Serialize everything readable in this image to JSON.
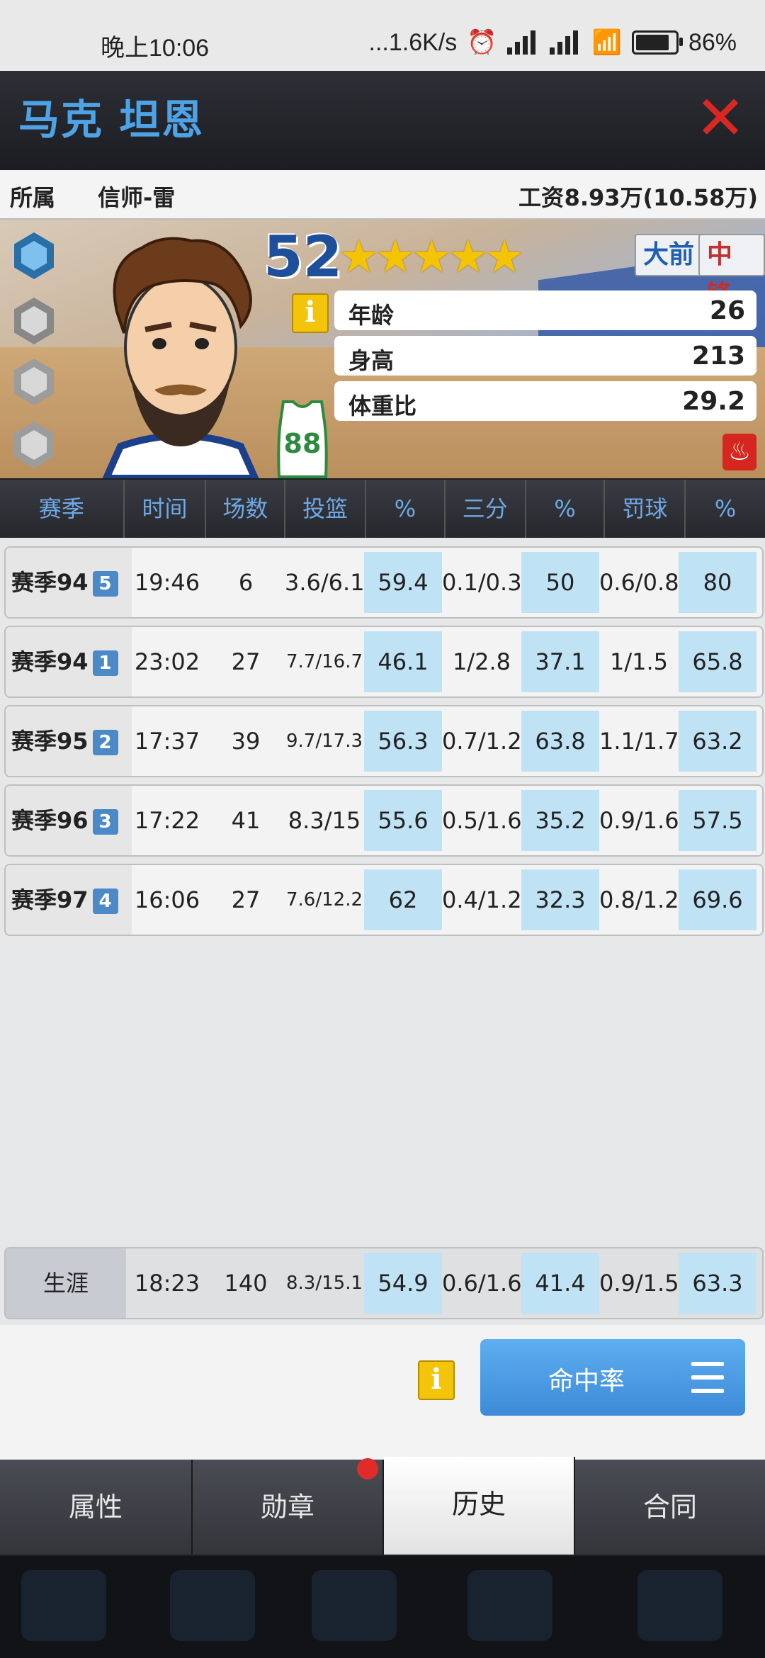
{
  "status": {
    "time": "晚上10:06",
    "network": "...1.6K/s",
    "battery": "86%",
    "battery_level": 0.86
  },
  "player": {
    "name": "马克 坦恩",
    "team_label": "所属",
    "team": "信师-雷",
    "salary_label": "工资",
    "salary": "8.93万(10.58万)",
    "rating": "52",
    "stars": "★★★★★",
    "star_rating": 4.5,
    "positions": [
      "大前",
      "中锋"
    ],
    "jersey": "88",
    "attributes": [
      {
        "label": "年龄",
        "value": "26"
      },
      {
        "label": "身高",
        "value": "213"
      },
      {
        "label": "体重比",
        "value": "29.2"
      }
    ]
  },
  "table": {
    "headers": [
      "赛季",
      "时间",
      "场数",
      "投篮",
      "%",
      "三分",
      "%",
      "罚球",
      "%"
    ],
    "rows": [
      {
        "season": "赛季94",
        "badge": "5",
        "time": "19:46",
        "games": "6",
        "fg": "3.6/6.1",
        "fg_pct": "59.4",
        "three": "0.1/0.3",
        "three_pct": "50",
        "ft": "0.6/0.8",
        "ft_pct": "80"
      },
      {
        "season": "赛季94",
        "badge": "1",
        "time": "23:02",
        "games": "27",
        "fg": "7.7/16.7",
        "fg_pct": "46.1",
        "three": "1/2.8",
        "three_pct": "37.1",
        "ft": "1/1.5",
        "ft_pct": "65.8"
      },
      {
        "season": "赛季95",
        "badge": "2",
        "time": "17:37",
        "games": "39",
        "fg": "9.7/17.3",
        "fg_pct": "56.3",
        "three": "0.7/1.2",
        "three_pct": "63.8",
        "ft": "1.1/1.7",
        "ft_pct": "63.2"
      },
      {
        "season": "赛季96",
        "badge": "3",
        "time": "17:22",
        "games": "41",
        "fg": "8.3/15",
        "fg_pct": "55.6",
        "three": "0.5/1.6",
        "three_pct": "35.2",
        "ft": "0.9/1.6",
        "ft_pct": "57.5"
      },
      {
        "season": "赛季97",
        "badge": "4",
        "time": "16:06",
        "games": "27",
        "fg": "7.6/12.2",
        "fg_pct": "62",
        "three": "0.4/1.2",
        "three_pct": "32.3",
        "ft": "0.8/1.2",
        "ft_pct": "69.6"
      }
    ],
    "career": {
      "season": "生涯",
      "time": "18:23",
      "games": "140",
      "fg": "8.3/15.1",
      "fg_pct": "54.9",
      "three": "0.6/1.6",
      "three_pct": "41.4",
      "ft": "0.9/1.5",
      "ft_pct": "63.3"
    }
  },
  "controls": {
    "info_icon": "i",
    "hit_rate_label": "命中率"
  },
  "tabs": [
    "属性",
    "勋章",
    "历史",
    "合同"
  ],
  "colors": {
    "accent": "#4ea2e6",
    "highlight": "#bfe2f5",
    "close": "#d92822"
  }
}
